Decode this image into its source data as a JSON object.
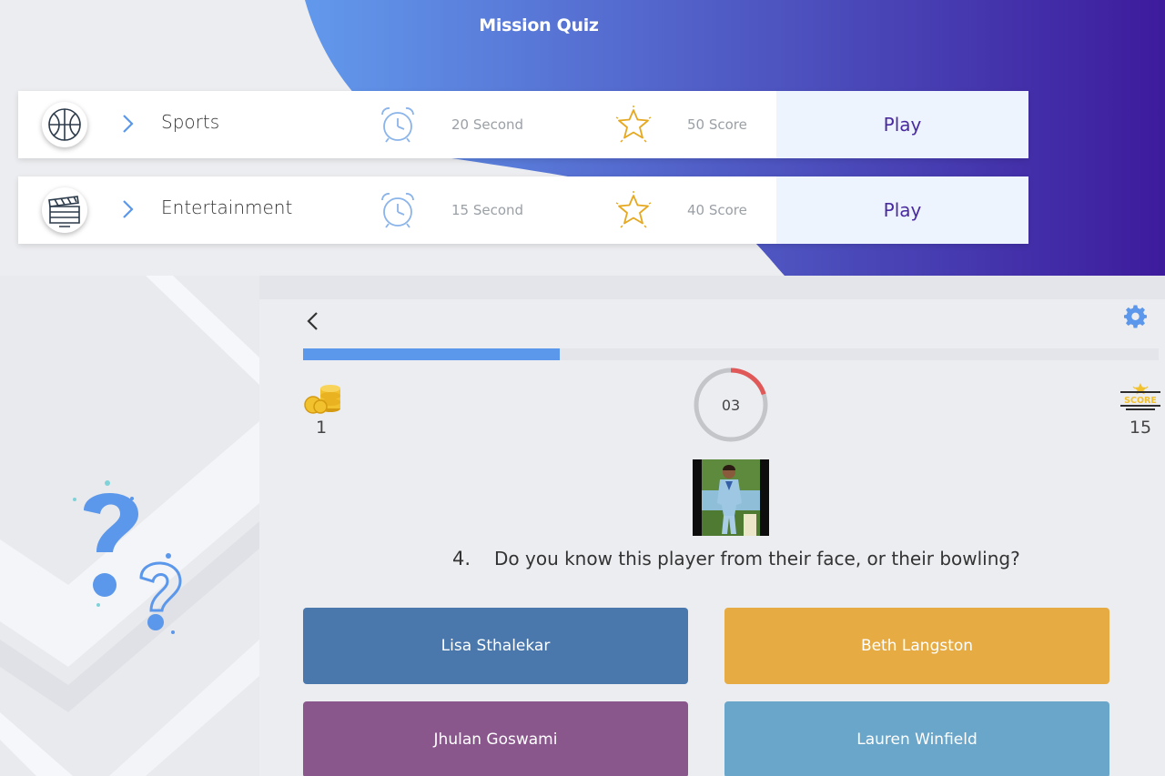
{
  "app": {
    "title": "Mission Quiz"
  },
  "categories": [
    {
      "name": "Sports",
      "time": "20 Second",
      "score": "50 Score",
      "play_label": "Play",
      "icon": "basketball-icon"
    },
    {
      "name": "Entertainment",
      "time": "15 Second",
      "score": "40 Score",
      "play_label": "Play",
      "icon": "clapperboard-icon"
    }
  ],
  "quiz": {
    "progress_percent": 30,
    "coins": "1",
    "timer": "03",
    "timer_fraction_remaining": 0.2,
    "score": "15",
    "score_badge_label": "SCORE",
    "question_number": "4.",
    "question_text": "Do you know this player from their face, or their bowling?",
    "answers": [
      {
        "label": "Lisa Sthalekar",
        "color": "#4a78ad"
      },
      {
        "label": "Beth Langston",
        "color": "#e6ab42"
      },
      {
        "label": "Jhulan Goswami",
        "color": "#8a578d"
      },
      {
        "label": "Lauren Winfield",
        "color": "#6aa6c9"
      }
    ]
  },
  "colors": {
    "accent": "#5b97ea",
    "play_text": "#4a2aa0",
    "header_gradient_start": "#6299ec",
    "header_gradient_end": "#3d1b9c",
    "timer_red": "#e05858"
  }
}
